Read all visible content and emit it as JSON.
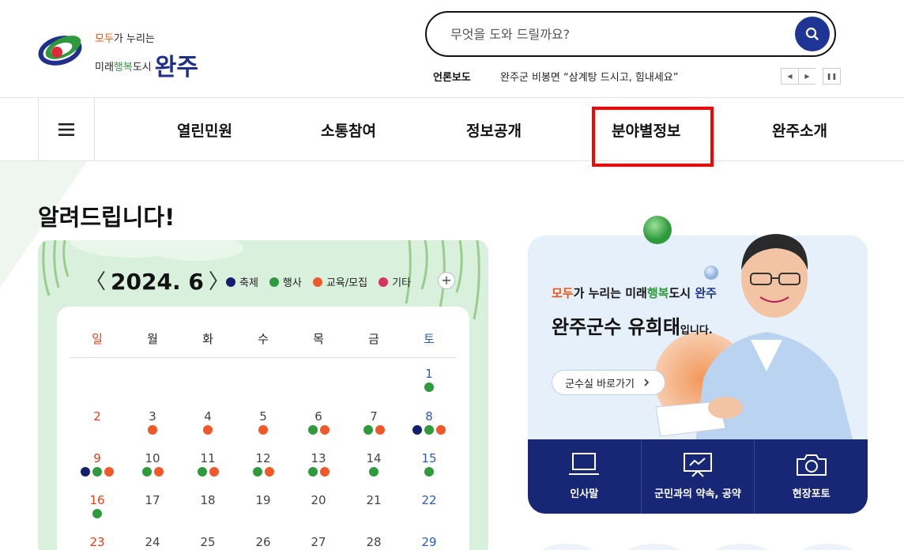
{
  "logo": {
    "line1_a": "모두",
    "line1_b": "가 누리는",
    "line2_a": "미래",
    "line2_b": "행복",
    "line2_c": "도시",
    "big": "완주"
  },
  "search": {
    "placeholder": "무엇을 도와 드릴까요?"
  },
  "press": {
    "label": "언론보도",
    "headline": "완주군 비봉면 “삼계탕 드시고, 힘내세요”",
    "prev": "◀",
    "next": "▶",
    "pause": "❚❚"
  },
  "nav": {
    "items": [
      "열린민원",
      "소통참여",
      "정보공개",
      "분야별정보",
      "완주소개"
    ]
  },
  "notice": {
    "title": "알려드립니다!"
  },
  "calendar": {
    "month": "2024. 6",
    "prev": "〈",
    "next": "〉",
    "legend": [
      {
        "label": "축제",
        "color": "#14206e"
      },
      {
        "label": "행사",
        "color": "#2e9a3e"
      },
      {
        "label": "교육/모집",
        "color": "#f0582a"
      },
      {
        "label": "기타",
        "color": "#d93263"
      }
    ],
    "add": "+",
    "weekdays": [
      "일",
      "월",
      "화",
      "수",
      "목",
      "금",
      "토"
    ],
    "colors": {
      "sun": "#e0401b",
      "sat": "#2a5bbd",
      "weekday": "#444"
    },
    "rows": [
      [
        null,
        null,
        null,
        null,
        null,
        null,
        {
          "d": "1",
          "e": [
            "g"
          ]
        }
      ],
      [
        {
          "d": "2",
          "e": []
        },
        {
          "d": "3",
          "e": [
            "o"
          ]
        },
        {
          "d": "4",
          "e": [
            "o"
          ]
        },
        {
          "d": "5",
          "e": [
            "o"
          ]
        },
        {
          "d": "6",
          "e": [
            "g",
            "o"
          ]
        },
        {
          "d": "7",
          "e": [
            "g",
            "o"
          ]
        },
        {
          "d": "8",
          "e": [
            "n",
            "g",
            "o"
          ]
        }
      ],
      [
        {
          "d": "9",
          "e": [
            "n",
            "g",
            "o"
          ]
        },
        {
          "d": "10",
          "e": [
            "g",
            "o"
          ]
        },
        {
          "d": "11",
          "e": [
            "g",
            "o"
          ]
        },
        {
          "d": "12",
          "e": [
            "g",
            "o"
          ]
        },
        {
          "d": "13",
          "e": [
            "g",
            "o"
          ]
        },
        {
          "d": "14",
          "e": [
            "g"
          ]
        },
        {
          "d": "15",
          "e": [
            "g"
          ]
        }
      ],
      [
        {
          "d": "16",
          "e": [
            "g"
          ]
        },
        {
          "d": "17",
          "e": []
        },
        {
          "d": "18",
          "e": []
        },
        {
          "d": "19",
          "e": []
        },
        {
          "d": "20",
          "e": []
        },
        {
          "d": "21",
          "e": []
        },
        {
          "d": "22",
          "e": []
        }
      ],
      [
        {
          "d": "23",
          "e": []
        },
        {
          "d": "24",
          "e": []
        },
        {
          "d": "25",
          "e": []
        },
        {
          "d": "26",
          "e": []
        },
        {
          "d": "27",
          "e": []
        },
        {
          "d": "28",
          "e": []
        },
        {
          "d": "29",
          "e": []
        }
      ]
    ]
  },
  "mayor": {
    "sub_a": "모두",
    "sub_b": "가 누리는 미래",
    "sub_c": "행복",
    "sub_d": "도시",
    "sub_e": "완주",
    "title": "완주군수 유희태",
    "title_suffix": "입니다.",
    "button": "군수실 바로가기",
    "button_icon": "chevron-right-icon"
  },
  "quick_links": [
    {
      "label": "인사말",
      "icon": "laptop-icon"
    },
    {
      "label": "군민과의 약속, 공약",
      "icon": "presentation-icon"
    },
    {
      "label": "현장포토",
      "icon": "camera-icon"
    }
  ],
  "colors": {
    "brand_blue": "#1f3596",
    "nav_highlight": "#ff0000",
    "quick_bg": "#172775",
    "calendar_bg": "#d9f0dc",
    "mayor_bg": "#e6f0fb"
  }
}
